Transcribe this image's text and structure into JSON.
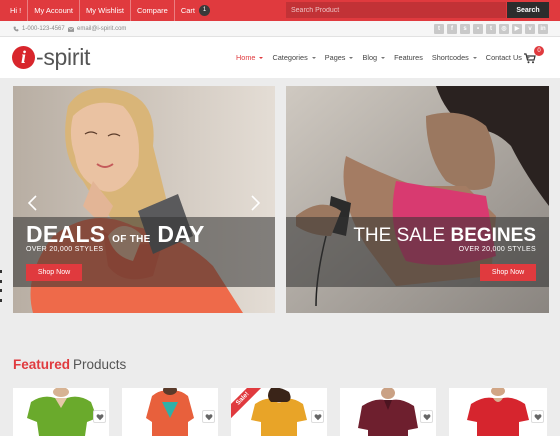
{
  "topbar": {
    "links": [
      "Hi !",
      "My Account",
      "My Wishlist",
      "Compare",
      "Cart"
    ],
    "cart_count": "1",
    "search_placeholder": "Search Product",
    "search_button": "Search"
  },
  "contact": {
    "phone": "1-000-123-4567",
    "email": "email@i-spirit.com",
    "social_icons": [
      "twitter-icon",
      "facebook-icon",
      "skype-icon",
      "flickr-icon",
      "tumblr-icon",
      "dribbble-icon",
      "youtube-icon",
      "vimeo-icon",
      "linkedin-icon"
    ]
  },
  "header": {
    "logo_letter": "i",
    "logo_text": "-spirit",
    "nav": [
      "Home",
      "Categories",
      "Pages",
      "Blog",
      "Features",
      "Shortcodes",
      "Contact Us"
    ],
    "cart_badge": "0"
  },
  "banners": {
    "left": {
      "heading_a": "DEALS",
      "heading_small": "OF THE",
      "heading_b": "DAY",
      "sub": "OVER 20,000 STYLES",
      "button": "Shop Now"
    },
    "right": {
      "heading_a": "THE SALE",
      "heading_b": "BEGINES",
      "sub": "OVER 20,000 STYLES",
      "button": "Shop Now"
    }
  },
  "featured": {
    "title_a": "Featured",
    "title_b": "Products",
    "sale_label": "Sale!",
    "products": [
      {
        "shirt_color": "#6aaa2c"
      },
      {
        "shirt_color": "#e8603c"
      },
      {
        "shirt_color": "#e8a428",
        "sale": true
      },
      {
        "shirt_color": "#6e1f2e"
      },
      {
        "shirt_color": "#d6252e"
      }
    ]
  },
  "colors": {
    "accent": "#e03a3e",
    "dark": "#2d2d2d"
  }
}
